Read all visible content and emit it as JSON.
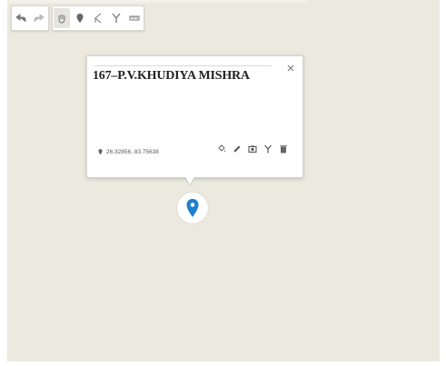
{
  "toolbar": {
    "groups": [
      [
        {
          "icon": "undo-icon"
        },
        {
          "icon": "redo-icon"
        }
      ],
      [
        {
          "icon": "pan-hand-icon",
          "active": true
        },
        {
          "icon": "marker-tool-icon"
        },
        {
          "icon": "line-tool-icon"
        },
        {
          "icon": "route-icon"
        },
        {
          "icon": "ruler-icon"
        }
      ]
    ]
  },
  "popup": {
    "title": "167–P.V.KHUDIYA MISHRA",
    "coordinates": "26.32856, 83.75638",
    "actions": [
      "paint-bucket-icon",
      "pencil-icon",
      "camera-icon",
      "route-icon",
      "trash-icon"
    ]
  },
  "colors": {
    "map_background": "#ece9df",
    "marker": "#1e7fd1",
    "icon": "#555555"
  }
}
